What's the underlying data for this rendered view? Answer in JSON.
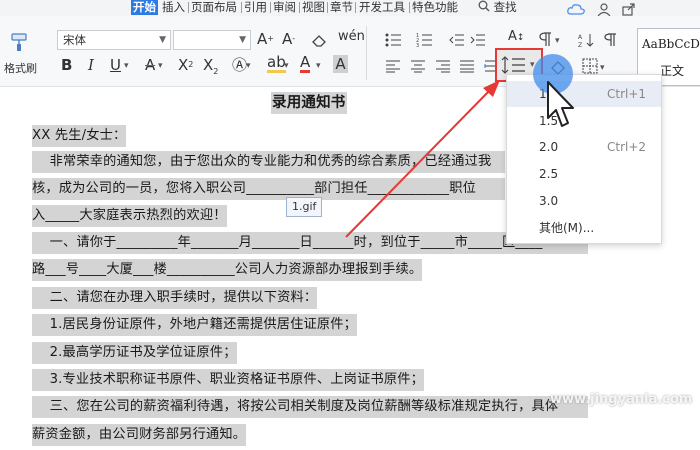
{
  "menu": {
    "tabs": [
      "开始",
      "插入",
      "页面布局",
      "引用",
      "审阅",
      "视图",
      "章节",
      "开发工具",
      "特色功能"
    ],
    "search_label": "查找"
  },
  "ribbon": {
    "format_painter_label": "格式刷",
    "font_name": "宋体",
    "font_size": "",
    "style_preview_text": "AaBbCcDd",
    "style_name": "正文"
  },
  "spacing_menu": {
    "items": [
      {
        "value": "1",
        "shortcut": "Ctrl+1"
      },
      {
        "value": "1.5",
        "shortcut": ""
      },
      {
        "value": "2.0",
        "shortcut": "Ctrl+2"
      },
      {
        "value": "2.5",
        "shortcut": ""
      },
      {
        "value": "3.0",
        "shortcut": ""
      },
      {
        "value": "其他(M)...",
        "shortcut": ""
      }
    ],
    "highlighted_index": 0
  },
  "tooltip": "1.gif",
  "document": {
    "title": "录用通知书",
    "lines": [
      "XX 先生/女士：",
      "    非常荣幸的通知您，由于您出众的专业能力和优秀的综合素质，已经通过我",
      "核，成为公司的一员，您将入职公司__________部门担任____________职位",
      "入_____大家庭表示热烈的欢迎！",
      "    一、请你于_________年_______月_______日______时，到位于_____市_____区____",
      "路___号____大厦___楼__________公司人力资源部办理报到手续。",
      "    二、请您在办理入职手续时，提供以下资料：",
      "    1.居民身份证原件，外地户籍还需提供居住证原件；",
      "    2.最高学历证书及学位证原件；",
      "    3.专业技术职称证书原件、职业资格证书原件、上岗证书原件；",
      "    三、您在公司的薪资福利待遇，将按公司相关制度及岗位薪酬等级标准规定执行，具体",
      "薪资金额，由公司财务部另行通知。"
    ]
  },
  "watermark": "www.jingyanla.com",
  "colors": {
    "accent": "#2c7be5",
    "highlight_box": "#e53935",
    "arrow": "#e53935",
    "text_highlight": "#d4d4d4"
  }
}
